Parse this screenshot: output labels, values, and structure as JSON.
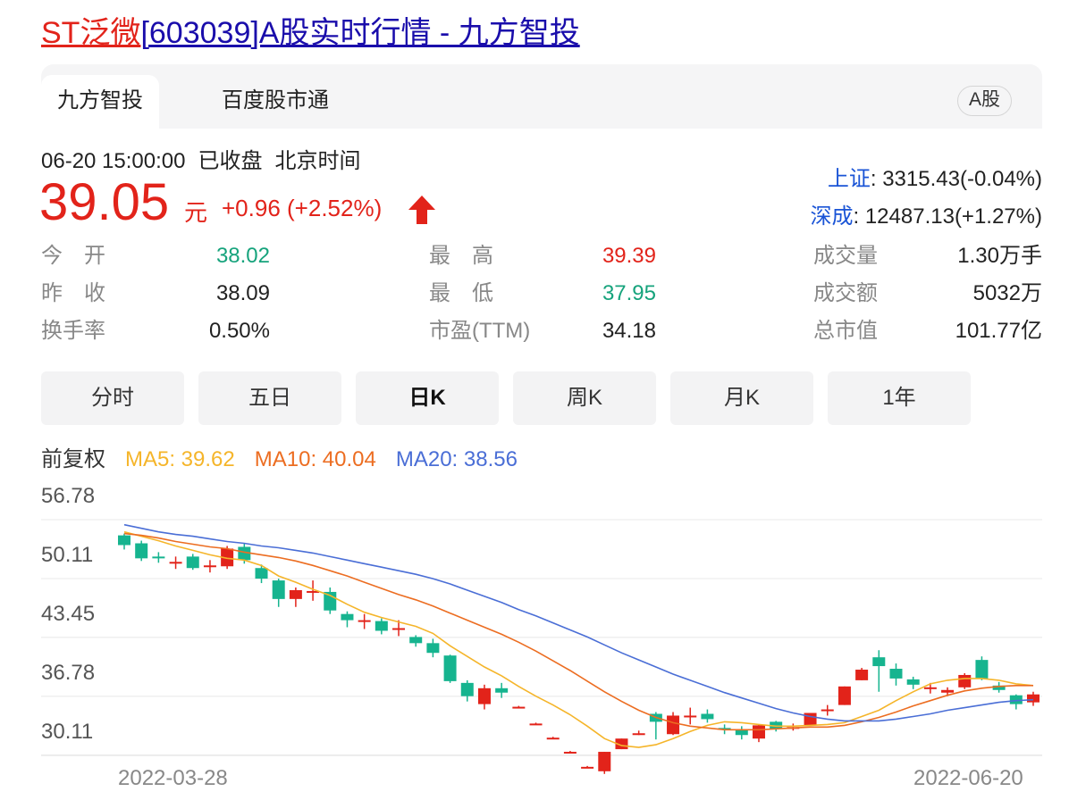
{
  "page_title": {
    "name": "ST泛微",
    "rest": "[603039]A股实时行情 - 九方智投"
  },
  "tabs": [
    {
      "label": "九方智投",
      "active": true
    },
    {
      "label": "百度股市通",
      "active": false
    }
  ],
  "market_badge": "A股",
  "quote": {
    "datetime": "06-20 15:00:00",
    "status": "已收盘",
    "timezone": "北京时间",
    "price": "39.05",
    "unit": "元",
    "change": "+0.96 (+2.52%)",
    "direction_icon": "arrow-up-icon"
  },
  "indices": [
    {
      "name": "上证",
      "value": ": 3315.43(-0.04%)"
    },
    {
      "name": "深成",
      "value": ": 12487.13(+1.27%)"
    }
  ],
  "stats": [
    {
      "label": "今　开",
      "value": "38.02",
      "color": "down"
    },
    {
      "label": "昨　收",
      "value": "38.09",
      "color": "neutral"
    },
    {
      "label": "换手率",
      "value": "0.50%",
      "color": "neutral"
    },
    {
      "label": "最　高",
      "value": "39.39",
      "color": "up"
    },
    {
      "label": "最　低",
      "value": "37.95",
      "color": "down"
    },
    {
      "label": "市盈(TTM)",
      "value": "34.18",
      "color": "neutral"
    },
    {
      "label": "成交量",
      "value": "1.30万手",
      "color": "neutral"
    },
    {
      "label": "成交额",
      "value": "5032万",
      "color": "neutral"
    },
    {
      "label": "总市值",
      "value": "101.77亿",
      "color": "neutral"
    }
  ],
  "periods": [
    {
      "label": "分时",
      "active": false
    },
    {
      "label": "五日",
      "active": false
    },
    {
      "label": "日K",
      "active": true
    },
    {
      "label": "周K",
      "active": false
    },
    {
      "label": "月K",
      "active": false
    },
    {
      "label": "1年",
      "active": false
    }
  ],
  "ma_legend": {
    "adjust": "前复权",
    "ma5": "MA5: 39.62",
    "ma10": "MA10: 40.04",
    "ma20": "MA20: 38.56"
  },
  "colors": {
    "up": "#e2231a",
    "down": "#16b48f",
    "ma5": "#f5b52a",
    "ma10": "#ec6d21",
    "ma20": "#4a6ed6",
    "grid": "#e8e8e8"
  },
  "chart_data": {
    "type": "candlestick",
    "y_ticks": [
      "56.78",
      "50.11",
      "43.45",
      "36.78",
      "30.11"
    ],
    "ylim": [
      28.0,
      56.78
    ],
    "x_labels": [
      "2022-03-28",
      "2022-06-20"
    ],
    "series": [
      {
        "name": "K线",
        "candles": [
          {
            "o": 55.0,
            "c": 53.9,
            "h": 55.2,
            "l": 53.4
          },
          {
            "o": 54.1,
            "c": 52.4,
            "h": 54.4,
            "l": 52.1
          },
          {
            "o": 52.6,
            "c": 52.5,
            "h": 53.1,
            "l": 51.9
          },
          {
            "o": 52.0,
            "c": 52.0,
            "h": 52.6,
            "l": 51.2
          },
          {
            "o": 52.6,
            "c": 51.3,
            "h": 52.9,
            "l": 51.1
          },
          {
            "o": 51.6,
            "c": 51.6,
            "h": 52.2,
            "l": 50.8
          },
          {
            "o": 51.5,
            "c": 53.5,
            "h": 53.8,
            "l": 51.2
          },
          {
            "o": 53.7,
            "c": 52.2,
            "h": 54.1,
            "l": 51.8
          },
          {
            "o": 51.3,
            "c": 50.1,
            "h": 51.7,
            "l": 49.6
          },
          {
            "o": 49.9,
            "c": 47.8,
            "h": 50.1,
            "l": 46.9
          },
          {
            "o": 47.8,
            "c": 48.8,
            "h": 49.1,
            "l": 46.9
          },
          {
            "o": 48.7,
            "c": 48.7,
            "h": 49.9,
            "l": 47.6
          },
          {
            "o": 48.6,
            "c": 46.5,
            "h": 49.1,
            "l": 46.1
          },
          {
            "o": 46.1,
            "c": 45.4,
            "h": 46.4,
            "l": 44.6
          },
          {
            "o": 45.4,
            "c": 45.4,
            "h": 46.1,
            "l": 44.4
          },
          {
            "o": 45.3,
            "c": 44.2,
            "h": 45.6,
            "l": 43.8
          },
          {
            "o": 44.5,
            "c": 44.5,
            "h": 45.4,
            "l": 43.6
          },
          {
            "o": 43.5,
            "c": 42.8,
            "h": 43.7,
            "l": 42.4
          },
          {
            "o": 42.8,
            "c": 41.7,
            "h": 43.3,
            "l": 41.2
          },
          {
            "o": 41.4,
            "c": 38.5,
            "h": 41.5,
            "l": 38.3
          },
          {
            "o": 38.3,
            "c": 36.8,
            "h": 38.6,
            "l": 36.2
          },
          {
            "o": 35.9,
            "c": 37.7,
            "h": 38.1,
            "l": 35.3
          },
          {
            "o": 37.7,
            "c": 37.2,
            "h": 38.3,
            "l": 36.6
          },
          {
            "o": 35.6,
            "c": 35.6,
            "h": 35.7,
            "l": 35.5
          },
          {
            "o": 33.7,
            "c": 33.7,
            "h": 33.8,
            "l": 33.6
          },
          {
            "o": 32.1,
            "c": 32.1,
            "h": 32.2,
            "l": 32.0
          },
          {
            "o": 30.5,
            "c": 30.5,
            "h": 30.6,
            "l": 30.4
          },
          {
            "o": 28.8,
            "c": 28.8,
            "h": 28.9,
            "l": 28.7
          },
          {
            "o": 28.3,
            "c": 30.5,
            "h": 30.5,
            "l": 28.0
          },
          {
            "o": 30.8,
            "c": 32.0,
            "h": 32.0,
            "l": 30.8
          },
          {
            "o": 32.6,
            "c": 32.6,
            "h": 32.9,
            "l": 32.4
          },
          {
            "o": 34.8,
            "c": 33.9,
            "h": 35.0,
            "l": 31.9
          },
          {
            "o": 32.5,
            "c": 34.6,
            "h": 35.0,
            "l": 32.4
          },
          {
            "o": 34.6,
            "c": 34.6,
            "h": 35.5,
            "l": 33.6
          },
          {
            "o": 34.8,
            "c": 34.2,
            "h": 35.3,
            "l": 33.8
          },
          {
            "o": 33.2,
            "c": 33.0,
            "h": 33.6,
            "l": 32.5
          },
          {
            "o": 33.0,
            "c": 32.4,
            "h": 33.4,
            "l": 31.9
          },
          {
            "o": 32.0,
            "c": 33.5,
            "h": 33.6,
            "l": 31.6
          },
          {
            "o": 33.9,
            "c": 33.1,
            "h": 34.0,
            "l": 32.8
          },
          {
            "o": 33.3,
            "c": 33.3,
            "h": 33.7,
            "l": 32.9
          },
          {
            "o": 33.5,
            "c": 34.9,
            "h": 34.9,
            "l": 33.5
          },
          {
            "o": 35.3,
            "c": 35.3,
            "h": 35.8,
            "l": 34.6
          },
          {
            "o": 35.8,
            "c": 37.9,
            "h": 37.9,
            "l": 35.8
          },
          {
            "o": 38.6,
            "c": 39.8,
            "h": 40.0,
            "l": 38.6
          },
          {
            "o": 41.2,
            "c": 40.2,
            "h": 42.0,
            "l": 37.3
          },
          {
            "o": 39.9,
            "c": 38.8,
            "h": 40.5,
            "l": 38.0
          },
          {
            "o": 38.7,
            "c": 38.1,
            "h": 39.0,
            "l": 37.6
          },
          {
            "o": 37.8,
            "c": 37.8,
            "h": 38.3,
            "l": 37.1
          },
          {
            "o": 37.2,
            "c": 37.5,
            "h": 37.8,
            "l": 36.8
          },
          {
            "o": 37.8,
            "c": 39.2,
            "h": 39.4,
            "l": 37.6
          },
          {
            "o": 40.9,
            "c": 38.8,
            "h": 41.3,
            "l": 38.6
          },
          {
            "o": 38.0,
            "c": 37.5,
            "h": 38.4,
            "l": 37.2
          },
          {
            "o": 36.9,
            "c": 35.9,
            "h": 37.0,
            "l": 35.3
          },
          {
            "o": 36.1,
            "c": 37.0,
            "h": 37.3,
            "l": 35.7
          }
        ]
      },
      {
        "name": "MA5",
        "values": [
          55.4,
          54.9,
          54.4,
          53.8,
          53.3,
          52.8,
          52.4,
          52.2,
          51.6,
          50.4,
          49.7,
          48.9,
          48.2,
          47.2,
          46.3,
          45.7,
          45.2,
          44.7,
          43.9,
          42.5,
          41.3,
          40.1,
          39.1,
          37.9,
          36.8,
          35.8,
          34.7,
          33.4,
          32.0,
          31.2,
          31.0,
          31.3,
          32.0,
          32.8,
          33.5,
          33.9,
          33.8,
          33.6,
          33.4,
          33.4,
          33.5,
          33.6,
          33.8,
          34.5,
          35.2,
          36.3,
          37.3,
          38.2,
          38.6,
          38.8,
          38.8,
          38.6,
          38.2,
          38.0
        ]
      },
      {
        "name": "MA10",
        "values": [
          55.2,
          55.0,
          54.7,
          54.3,
          54.0,
          53.7,
          53.5,
          53.1,
          52.8,
          52.5,
          52.1,
          51.6,
          51.0,
          50.4,
          49.7,
          49.0,
          48.3,
          47.7,
          47.0,
          46.2,
          45.4,
          44.6,
          43.8,
          42.9,
          41.9,
          40.8,
          39.7,
          38.5,
          37.3,
          36.2,
          35.2,
          34.4,
          33.8,
          33.4,
          33.2,
          33.0,
          33.0,
          33.0,
          33.1,
          33.2,
          33.3,
          33.3,
          33.5,
          33.9,
          34.4,
          35.0,
          35.7,
          36.3,
          36.9,
          37.4,
          37.7,
          37.9,
          38.0,
          38.0
        ]
      },
      {
        "name": "MA20",
        "values": [
          56.2,
          55.8,
          55.4,
          55.1,
          54.9,
          54.6,
          54.3,
          54.1,
          53.8,
          53.6,
          53.3,
          53.0,
          52.6,
          52.2,
          51.8,
          51.4,
          51.0,
          50.6,
          50.1,
          49.5,
          48.8,
          48.1,
          47.4,
          46.6,
          45.9,
          45.1,
          44.3,
          43.5,
          42.6,
          41.7,
          40.9,
          40.1,
          39.3,
          38.6,
          37.9,
          37.2,
          36.6,
          36.0,
          35.4,
          34.9,
          34.5,
          34.2,
          34.0,
          34.0,
          34.0,
          34.2,
          34.5,
          34.8,
          35.2,
          35.5,
          35.8,
          36.1,
          36.3,
          36.4
        ]
      }
    ]
  }
}
